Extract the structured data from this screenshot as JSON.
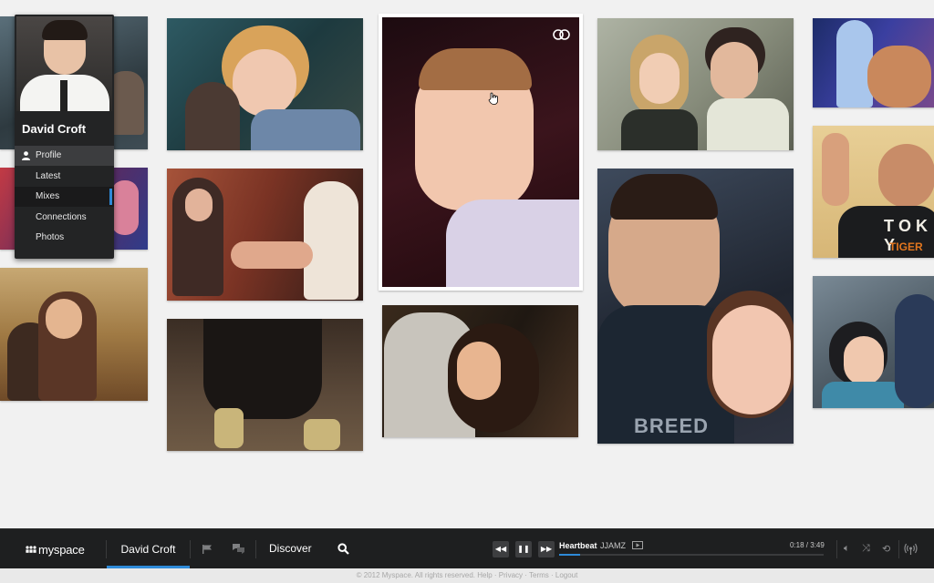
{
  "profile": {
    "name": "David Croft",
    "menu": [
      {
        "label": "Profile",
        "active": true
      },
      {
        "label": "Latest"
      },
      {
        "label": "Mixes"
      },
      {
        "label": "Connections"
      },
      {
        "label": "Photos"
      }
    ]
  },
  "player": {
    "logo": "myspace",
    "user_tab": "David Croft",
    "discover": "Discover",
    "track_title": "Heartbeat",
    "track_artist": "JJAMZ",
    "time": "0:18 / 3:49",
    "progress": 0.078
  },
  "photo_tags": [
    "T O K Y",
    "TIGER",
    "BREED"
  ],
  "footer": "© 2012 Myspace. All rights reserved. Help · Privacy · Terms · Logout",
  "colors": {
    "accent": "#2e8ad8",
    "bar": "#1e1f20"
  }
}
